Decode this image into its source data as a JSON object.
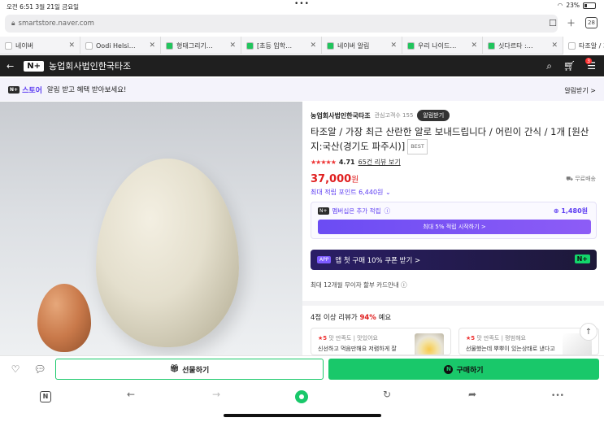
{
  "status_bar": {
    "time": "오전 6:51",
    "date": "3월 21일 금요일",
    "battery": "23%"
  },
  "browser": {
    "url": "smartstore.naver.com",
    "tab_count": "28",
    "tabs": [
      {
        "label": "네이버",
        "color": "#ffffff"
      },
      {
        "label": "Oodi Helsi…",
        "color": "#ffffff"
      },
      {
        "label": "형태그리기…",
        "color": "#21c55d"
      },
      {
        "label": "[초등 입학…",
        "color": "#21c55d"
      },
      {
        "label": "네이버 알림",
        "color": "#21c55d"
      },
      {
        "label": "우리 나이드…",
        "color": "#21c55d"
      },
      {
        "label": "싯다르타 :…",
        "color": "#21c55d"
      },
      {
        "label": "타조알 / 가장…",
        "color": "#ffffff"
      }
    ],
    "toolbar": {
      "n_label": "N"
    }
  },
  "header": {
    "logo": "N+",
    "store_name": "농업회사법인한국타조",
    "cart_count": "3"
  },
  "promo": {
    "store_label": "스토어",
    "text": "알림 받고 혜택 받아보세요!",
    "alarm_label": "알림받기 >"
  },
  "product": {
    "seller": "농업회사법인한국타조",
    "fav_count": "관심고객수 155",
    "notify_label": "알림받기",
    "title": "타조알 / 가장 최근 산란한 알로 보내드립니다 / 어린이 간식 / 1개 [원산지:국산(경기도 파주시)]",
    "best_badge": "BEST",
    "stars": "★★★★★",
    "rating": "4.71",
    "review_link": "65건 리뷰 보기",
    "price": "37,000",
    "price_unit": "원",
    "shipping": "무료배송",
    "max_points": "최대 적립 포인트 6,440원",
    "membership_label": "멤버십은 추가 적립",
    "membership_points": "1,480원",
    "membership_button": "최대 5% 적립 시작하기 >",
    "app_badge": "APP",
    "app_text": "앱 첫 구매 10% 쿠폰 받기 >",
    "app_logo": "N+",
    "card_text": "최대 12개월 무이자 할부 카드안내"
  },
  "reviews": {
    "head_prefix": "4점 이상 리뷰가",
    "head_pct": "94%",
    "head_suffix": "예요",
    "cards": [
      {
        "score": "★5",
        "meta": "맛 만족도 | 맛있어요",
        "body": "신선하고 먹음만해요 저렴하게 잘"
      },
      {
        "score": "★5",
        "meta": "맛 만족도 | 평범해요",
        "body": "선물했는데 뿌뿌이 있는상태로 냈다고"
      }
    ]
  },
  "buy_bar": {
    "gift_label": "선물하기",
    "buy_label": "구매하기",
    "buy_logo": "N"
  }
}
